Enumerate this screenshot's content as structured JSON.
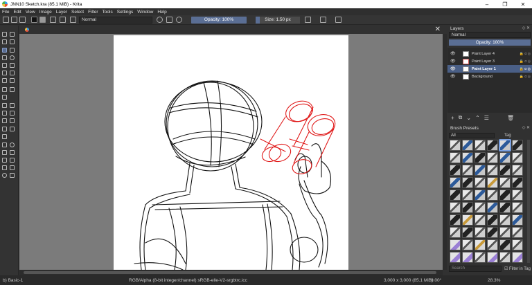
{
  "window": {
    "title": "JNN10 Sketch.kra (85.1 MiB)  - Krita",
    "controls": [
      "–",
      "❐",
      "✕"
    ]
  },
  "menu": [
    "File",
    "Edit",
    "View",
    "Image",
    "Layer",
    "Select",
    "Filter",
    "Tools",
    "Settings",
    "Window",
    "Help"
  ],
  "toolbar": {
    "blend_mode": "Normal",
    "opacity": "Opacity: 100%",
    "size": "Size: 1.50 px"
  },
  "canvas": {
    "close_label": "✕"
  },
  "layers": {
    "title": "Layers",
    "blend_mode": "Normal",
    "opacity": "Opacity:  100%",
    "items": [
      {
        "name": "Paint Layer 4",
        "selected": false
      },
      {
        "name": "Paint Layer 3",
        "selected": false
      },
      {
        "name": "Paint Layer 1",
        "selected": true
      },
      {
        "name": "Background",
        "selected": false
      }
    ]
  },
  "presets": {
    "title": "Brush Presets",
    "filter": "All",
    "tag_label": "Tag",
    "search_placeholder": "Search",
    "filter_in_tag": "Filter in Tag"
  },
  "status": {
    "preset": "b) Basic-1",
    "color_space": "RGB/Alpha (8-bit integer/channel)  sRGB-elle-V2-srgbtrc.icc",
    "dimensions": "3,000 x 3,000 (85.1 MiB)",
    "rotation": "0.00°",
    "zoom": "28.3%"
  },
  "colors": {
    "accent": "#5a6e94",
    "sketch_red": "#e01818",
    "sketch_black": "#111111"
  }
}
